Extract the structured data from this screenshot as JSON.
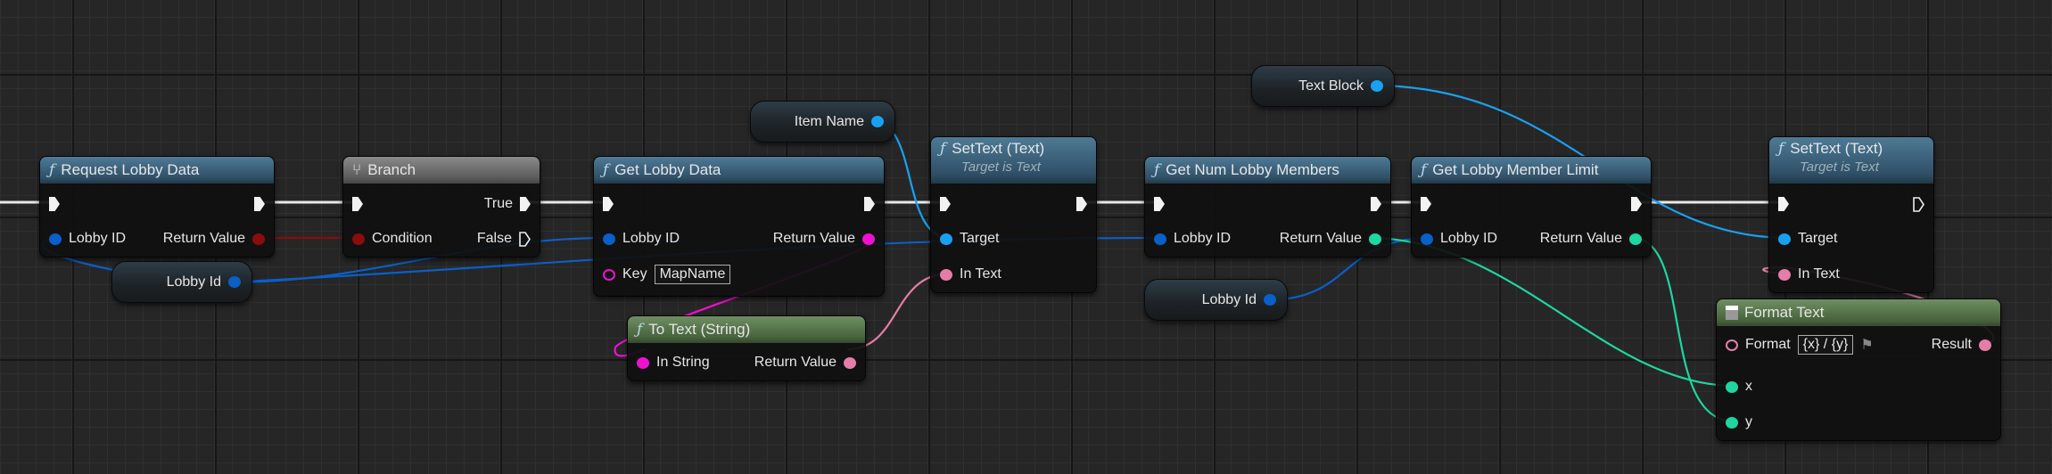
{
  "nodes": {
    "request_lobby_data": {
      "title": "Request Lobby Data",
      "inputs": [
        "Lobby ID"
      ],
      "outputs": [
        "Return Value"
      ]
    },
    "branch": {
      "title": "Branch",
      "inputs": [
        "Condition"
      ],
      "outputs": [
        "True",
        "False"
      ]
    },
    "get_lobby_data": {
      "title": "Get Lobby Data",
      "inputs": [
        "Lobby ID",
        "Key"
      ],
      "key_value": "MapName",
      "outputs": [
        "Return Value"
      ]
    },
    "set_text_1": {
      "title": "SetText (Text)",
      "subtitle": "Target is Text",
      "inputs": [
        "Target",
        "In Text"
      ]
    },
    "to_text": {
      "title": "To Text (String)",
      "inputs": [
        "In String"
      ],
      "outputs": [
        "Return Value"
      ]
    },
    "get_num_lobby_members": {
      "title": "Get Num Lobby Members",
      "inputs": [
        "Lobby ID"
      ],
      "outputs": [
        "Return Value"
      ]
    },
    "get_lobby_member_limit": {
      "title": "Get Lobby Member Limit",
      "inputs": [
        "Lobby ID"
      ],
      "outputs": [
        "Return Value"
      ]
    },
    "set_text_2": {
      "title": "SetText (Text)",
      "subtitle": "Target is Text",
      "inputs": [
        "Target",
        "In Text"
      ]
    },
    "format_text": {
      "title": "Format Text",
      "inputs": [
        "Format",
        "x",
        "y"
      ],
      "format_value": "{x} / {y}",
      "outputs": [
        "Result"
      ]
    }
  },
  "variables": {
    "lobby_id_1": "Lobby Id",
    "lobby_id_2": "Lobby Id",
    "item_name": "Item Name",
    "text_block": "Text Block"
  },
  "colors": {
    "exec": "#f2f2f2",
    "object": "#0a5fc8",
    "widget": "#1aa0f0",
    "bool": "#8a0c0c",
    "string": "#f010d0",
    "text": "#e47ea8",
    "int": "#1ed6a0"
  }
}
